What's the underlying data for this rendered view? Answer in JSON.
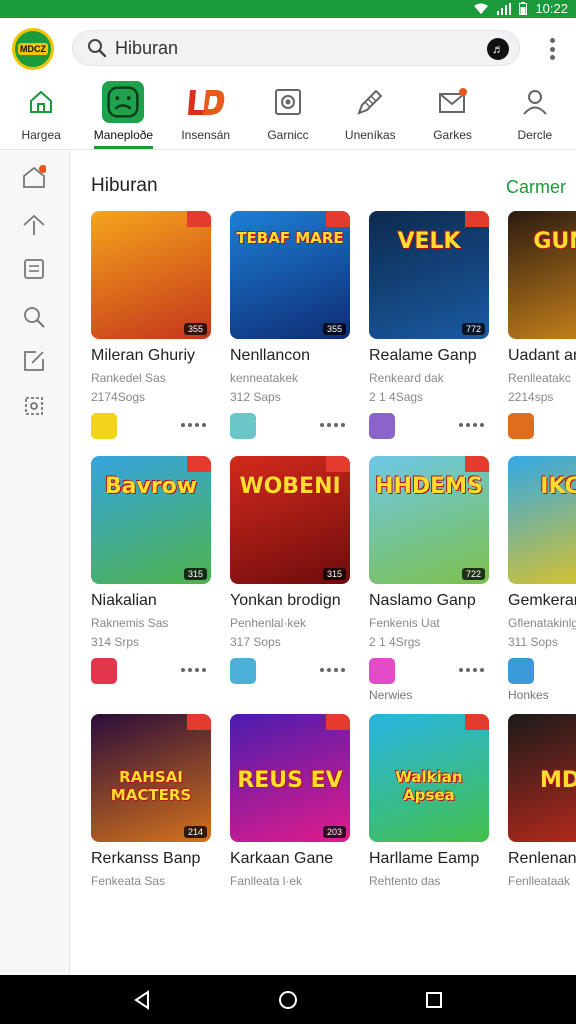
{
  "status": {
    "time": "10:22",
    "icons": [
      "wifi-icon",
      "signal-icon",
      "battery-icon"
    ]
  },
  "header": {
    "logo_text": "MDCZ",
    "search": {
      "value": "Hiburan",
      "placeholder": "Hiburan"
    }
  },
  "tabs": [
    {
      "label": "Hargea",
      "icon": "home-icon",
      "active": false
    },
    {
      "label": "Maneploðe",
      "icon": "app-face-icon",
      "active": true
    },
    {
      "label": "Insensán",
      "icon": "ld-logo-icon",
      "active": false
    },
    {
      "label": "Garnicc",
      "icon": "camera-icon",
      "active": false
    },
    {
      "label": "Uneníkas",
      "icon": "pen-icon",
      "active": false
    },
    {
      "label": "Garkes",
      "icon": "mail-icon",
      "active": false
    },
    {
      "label": "Dercle",
      "icon": "person-icon",
      "active": false
    }
  ],
  "sidebar": [
    "home-badge-icon",
    "upload-icon",
    "list-icon",
    "search-icon",
    "share-icon",
    "settings-icon"
  ],
  "section": {
    "title": "Hiburan",
    "see_all": "Carmer"
  },
  "rows": [
    [
      {
        "name": "Mileran Ghuriy",
        "sub": "Rankedel Sas",
        "size": "2174Sogs",
        "badge": "355",
        "thumb_text": "",
        "colors": [
          "#f6a41c",
          "#c3361c"
        ],
        "icon_color": "#f1d21c",
        "extra": ""
      },
      {
        "name": "Nenllancon",
        "sub": "kenneatakek",
        "size": "312 Saps",
        "badge": "355",
        "thumb_text": "TEBAF MARE",
        "colors": [
          "#1d7fd6",
          "#0e2c74"
        ],
        "icon_color": "#6bc6c8",
        "extra": ""
      },
      {
        "name": "Realame Ganp",
        "sub": "Renkeard dak",
        "size": "2 1 4Sags",
        "badge": "772",
        "thumb_text": "VELK",
        "colors": [
          "#0c2a4e",
          "#1a5aa2"
        ],
        "icon_color": "#8a64c8",
        "extra": ""
      },
      {
        "name": "Uadant an",
        "sub": "Renlleatakc",
        "size": "2214sps",
        "badge": "",
        "thumb_text": "GUNE",
        "colors": [
          "#2b1a10",
          "#d48a1c"
        ],
        "icon_color": "#e06d1c",
        "extra": ""
      }
    ],
    [
      {
        "name": "Niakalian",
        "sub": "Raknemis Sas",
        "size": "314 Srps",
        "badge": "315",
        "thumb_text": "Bavrow",
        "colors": [
          "#35a4e0",
          "#4fb34c"
        ],
        "icon_color": "#e2364c",
        "extra": ""
      },
      {
        "name": "Yonkan brodign",
        "sub": "Penhenlal·kek",
        "size": "317 Sops",
        "badge": "315",
        "thumb_text": "WOBENI",
        "colors": [
          "#d42a1c",
          "#6e0c0c"
        ],
        "icon_color": "#4cb0d8",
        "extra": ""
      },
      {
        "name": "Naslamo Ganp",
        "sub": "Fenkenis Uat",
        "size": "2 1 4Srgs",
        "badge": "722",
        "thumb_text": "HHDEMS",
        "colors": [
          "#6ec8e8",
          "#7cc04c"
        ],
        "icon_color": "#e24cc8",
        "extra": "Nerwies"
      },
      {
        "name": "Gemkeram",
        "sub": "Gflenatakinlg",
        "size": "311 Sops",
        "badge": "",
        "thumb_text": "IKCF",
        "colors": [
          "#32a8e6",
          "#e6c41c"
        ],
        "icon_color": "#3a9ad8",
        "extra": "Honkes"
      }
    ],
    [
      {
        "name": "Rerkanss Banp",
        "sub": "Fenkeata Sas",
        "size": "",
        "badge": "214",
        "thumb_text": "RAHSAI MACTERS",
        "colors": [
          "#2a0c3a",
          "#d4721c"
        ],
        "icon_color": "#000",
        "extra": ""
      },
      {
        "name": "Karkaan Gane",
        "sub": "Fanlleata l·ek",
        "size": "",
        "badge": "203",
        "thumb_text": "REUS EV",
        "colors": [
          "#4a1cae",
          "#e21c8a"
        ],
        "icon_color": "#000",
        "extra": ""
      },
      {
        "name": "Harllame Eamp",
        "sub": "Rehtento das",
        "size": "",
        "badge": "",
        "thumb_text": "Walkian Apsea",
        "colors": [
          "#28b4e4",
          "#44c04c"
        ],
        "icon_color": "#000",
        "extra": ""
      },
      {
        "name": "Renlenans",
        "sub": "Fenlleataak",
        "size": "",
        "badge": "",
        "thumb_text": "MDS",
        "colors": [
          "#1a1a1a",
          "#c42a1c"
        ],
        "icon_color": "#000",
        "extra": ""
      }
    ]
  ],
  "navbar": [
    "back-icon",
    "home-circle-icon",
    "recents-icon"
  ]
}
